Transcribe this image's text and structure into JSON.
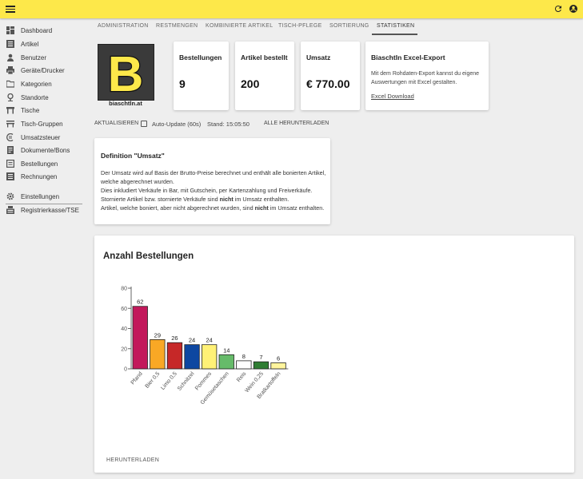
{
  "sidebar": {
    "items": [
      {
        "label": "Dashboard",
        "icon": "dashboard-icon"
      },
      {
        "label": "Artikel",
        "icon": "list-icon"
      },
      {
        "label": "Benutzer",
        "icon": "person-icon"
      },
      {
        "label": "Geräte/Drucker",
        "icon": "printer-icon"
      },
      {
        "label": "Kategorien",
        "icon": "folder-icon"
      },
      {
        "label": "Standorte",
        "icon": "pin-icon"
      },
      {
        "label": "Tische",
        "icon": "table-icon"
      },
      {
        "label": "Tisch-Gruppen",
        "icon": "table-group-icon"
      },
      {
        "label": "Umsatzsteuer",
        "icon": "tax-icon"
      },
      {
        "label": "Dokumente/Bons",
        "icon": "document-icon"
      },
      {
        "label": "Bestellungen",
        "icon": "orders-icon"
      },
      {
        "label": "Rechnungen",
        "icon": "invoice-icon"
      },
      {
        "label": "Einstellungen",
        "icon": "gear-icon"
      },
      {
        "label": "Registrierkasse/TSE",
        "icon": "register-icon"
      }
    ]
  },
  "tabs": [
    "ADMINISTRATION",
    "RESTMENGEN",
    "KOMBINIERTE ARTIKEL",
    "TISCH-PFLEGE",
    "SORTIERUNG",
    "STATISTIKEN"
  ],
  "active_tab": "STATISTIKEN",
  "logo": {
    "letter": "B",
    "caption": "biaschtln.at"
  },
  "stats": [
    {
      "title": "Bestellungen",
      "value": "9"
    },
    {
      "title": "Artikel bestellt",
      "value": "200"
    },
    {
      "title": "Umsatz",
      "value": "€ 770.00"
    }
  ],
  "export": {
    "title": "BiaschtIn Excel-Export",
    "text": "Mit dem Rohdaten-Export kannst du eigene Auswertungen mit Excel gestalten.",
    "link": "Excel Download"
  },
  "controls": {
    "refresh": "AKTUALISIEREN",
    "autoupdate": "Auto-Update (60s)",
    "stand": "Stand: 15:05:50",
    "download_all": "ALLE HERUNTERLADEN"
  },
  "definition": {
    "title": "Definition \"Umsatz\"",
    "p1": "Der Umsatz wird auf Basis der Brutto-Preise berechnet und enthält alle bonierten Artikel, welche abgerechnet wurden.",
    "p2": "Dies inkludiert Verkäufe in Bar, mit Gutschein, per Kartenzahlung und Freiverkäufe.",
    "p3a": "Stornierte Artikel bzw. stornierte Verkäufe sind ",
    "p3b": "nicht",
    "p3c": " im Umsatz enthalten.",
    "p4a": "Artikel, welche boniert, aber nicht abgerechnet wurden, sind ",
    "p4b": "nicht",
    "p4c": " im Umsatz enthalten."
  },
  "chart_section": {
    "download": "HERUNTERLADEN"
  },
  "chart_data": {
    "type": "bar",
    "title": "Anzahl Bestellungen",
    "xlabel": "",
    "ylabel": "",
    "ylim": [
      0,
      80
    ],
    "yticks": [
      0,
      20,
      40,
      60,
      80
    ],
    "categories": [
      "Pfand",
      "Bier 0,5",
      "Limo 0,5",
      "Schnitzel",
      "Pommes",
      "Gemüsetaschen",
      "Reis",
      "Wein 0,25",
      "Bratkartoffeln"
    ],
    "values": [
      62,
      29,
      26,
      24,
      24,
      14,
      8,
      7,
      6
    ],
    "colors": [
      "#c2185b",
      "#f9a825",
      "#c62828",
      "#0d47a1",
      "#fff176",
      "#66bb6a",
      "#ffffff",
      "#2e7d32",
      "#fff59d"
    ],
    "grid": false,
    "legend": "none"
  }
}
